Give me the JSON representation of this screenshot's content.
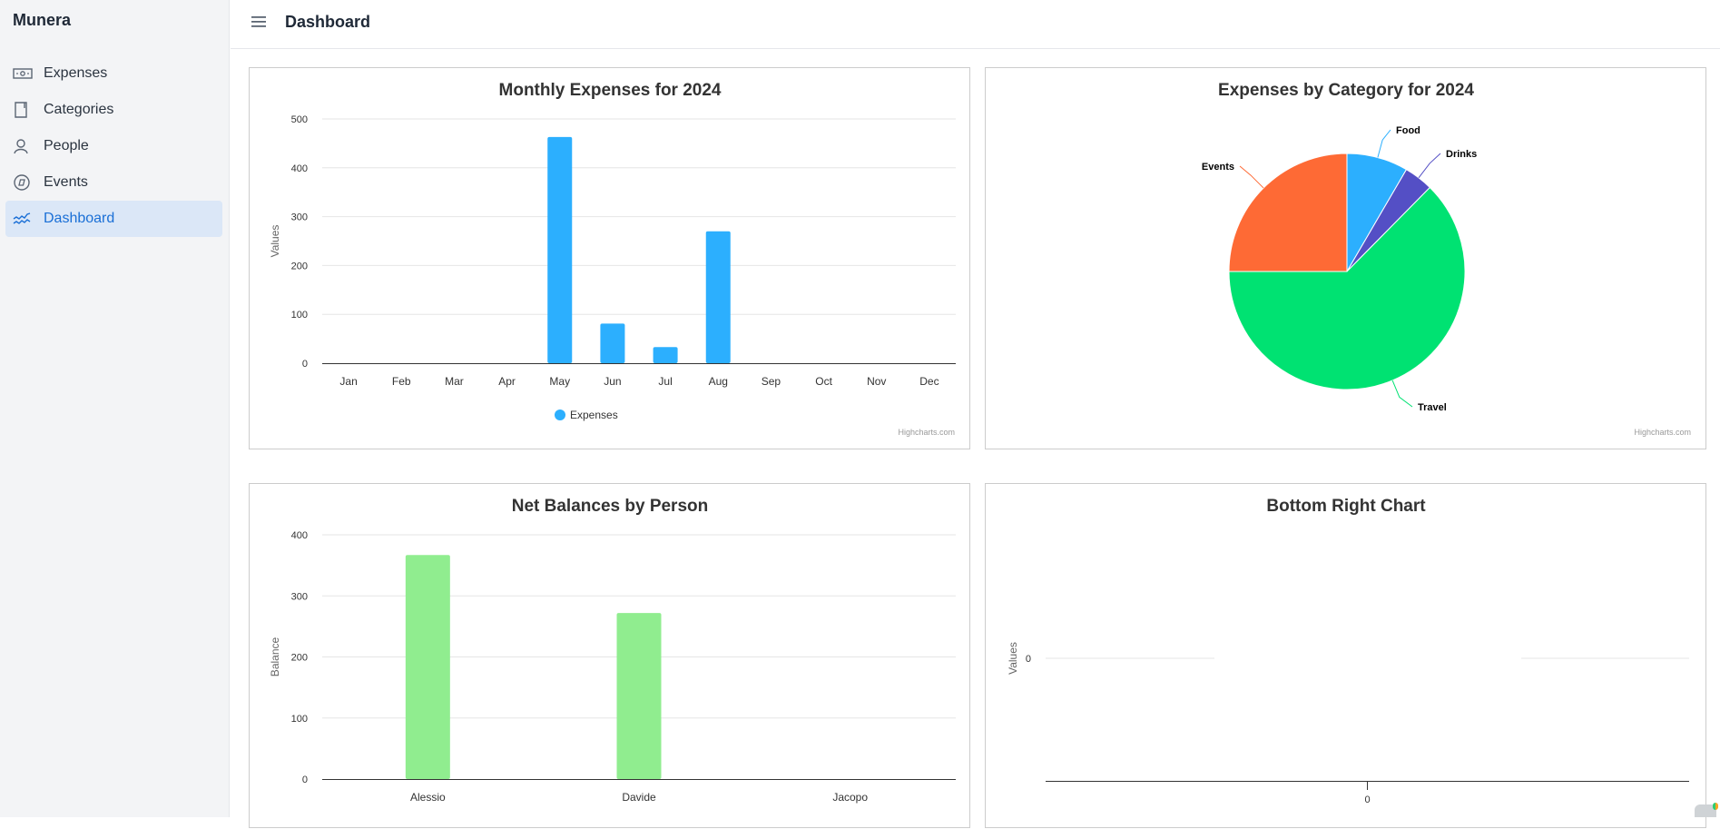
{
  "app": {
    "brand": "Munera"
  },
  "sidebar": {
    "items": [
      {
        "label": "Expenses",
        "icon": "banknote-icon",
        "active": false
      },
      {
        "label": "Categories",
        "icon": "book-icon",
        "active": false
      },
      {
        "label": "People",
        "icon": "user-icon",
        "active": false
      },
      {
        "label": "Events",
        "icon": "compass-icon",
        "active": false
      },
      {
        "label": "Dashboard",
        "icon": "chart-line-icon",
        "active": true
      }
    ]
  },
  "header": {
    "title": "Dashboard",
    "menu_icon": "hamburger-icon"
  },
  "credits": "Highcharts.com",
  "colors": {
    "accent": "#1a6fd6",
    "active_bg": "#dbe7f7",
    "bar_blue": "#2caffe",
    "bar_green": "#90ed8f"
  },
  "chart_data": [
    {
      "id": "monthly",
      "type": "bar",
      "title": "Monthly Expenses for 2024",
      "xlabel": "",
      "ylabel": "Values",
      "categories": [
        "Jan",
        "Feb",
        "Mar",
        "Apr",
        "May",
        "Jun",
        "Jul",
        "Aug",
        "Sep",
        "Oct",
        "Nov",
        "Dec"
      ],
      "series": [
        {
          "name": "Expenses",
          "color": "#2caffe",
          "values": [
            0,
            0,
            0,
            0,
            463,
            81,
            33,
            270,
            0,
            0,
            0,
            0
          ]
        }
      ],
      "ylim": [
        0,
        500
      ],
      "yticks": [
        0,
        100,
        200,
        300,
        400,
        500
      ],
      "grid": true,
      "legend": "bottom-center"
    },
    {
      "id": "category",
      "type": "pie",
      "title": "Expenses by Category for 2024",
      "slices": [
        {
          "label": "Food",
          "value": 8.4,
          "color": "#2caffe"
        },
        {
          "label": "Drinks",
          "value": 4.0,
          "color": "#544fc5"
        },
        {
          "label": "Travel",
          "value": 62.6,
          "color": "#00e272"
        },
        {
          "label": "Events",
          "value": 25.0,
          "color": "#fe6a35"
        }
      ]
    },
    {
      "id": "balances",
      "type": "bar",
      "title": "Net Balances by Person",
      "xlabel": "",
      "ylabel": "Balance",
      "categories": [
        "Alessio",
        "Davide",
        "Jacopo"
      ],
      "series": [
        {
          "name": "Balance",
          "color": "#90ed8f",
          "values": [
            367,
            272,
            0
          ]
        }
      ],
      "ylim": [
        0,
        400
      ],
      "yticks": [
        0,
        100,
        200,
        300,
        400
      ],
      "grid": true,
      "legend": "none"
    },
    {
      "id": "bottomright",
      "type": "line",
      "title": "Bottom Right Chart",
      "xlabel": "",
      "ylabel": "Values",
      "x": [
        0
      ],
      "series": [],
      "yticks": [
        0
      ],
      "xticks": [
        0
      ],
      "grid": true,
      "legend": "none"
    }
  ]
}
